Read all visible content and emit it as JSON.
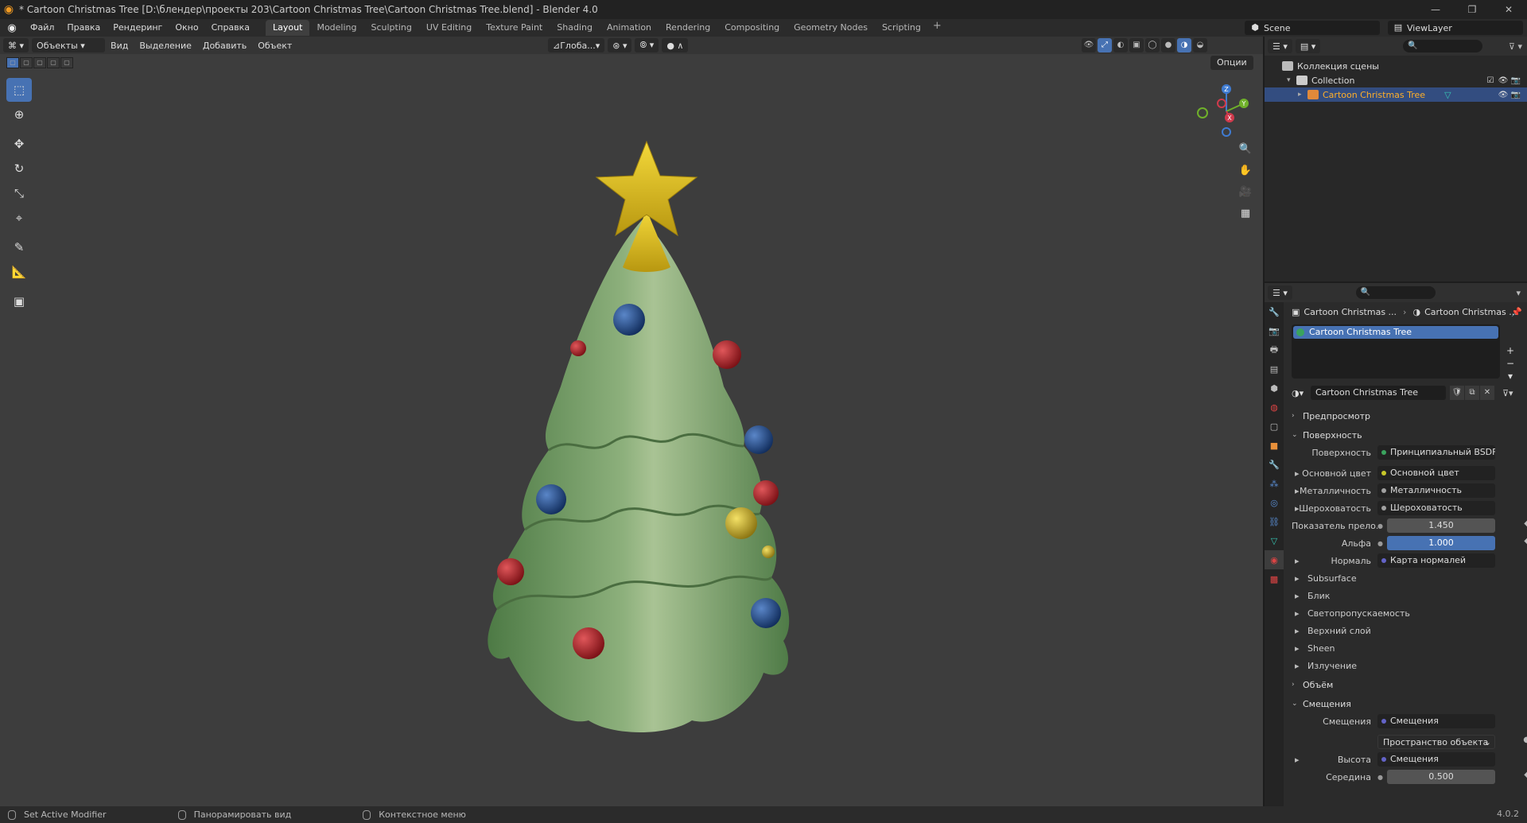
{
  "window": {
    "title": "* Cartoon Christmas Tree [D:\\блендер\\проекты 203\\Cartoon Christmas Tree\\Cartoon Christmas Tree.blend] - Blender 4.0"
  },
  "menu": [
    "Файл",
    "Правка",
    "Рендеринг",
    "Окно",
    "Справка"
  ],
  "workspaces": [
    "Layout",
    "Modeling",
    "Sculpting",
    "UV Editing",
    "Texture Paint",
    "Shading",
    "Animation",
    "Rendering",
    "Compositing",
    "Geometry Nodes",
    "Scripting"
  ],
  "active_workspace": "Layout",
  "scene": {
    "name": "Scene",
    "view_layer": "ViewLayer"
  },
  "viewport": {
    "mode": "Объекты",
    "menus": [
      "Вид",
      "Выделение",
      "Добавить",
      "Объект"
    ],
    "orientation": "Глоба...",
    "options_label": "Опции"
  },
  "outliner": {
    "root": "Коллекция сцены",
    "collection": "Collection",
    "object": "Cartoon Christmas Tree"
  },
  "properties": {
    "breadcrumb_object": "Cartoon Christmas ...",
    "breadcrumb_material": "Cartoon Christmas ...",
    "material_slot": "Cartoon Christmas Tree",
    "material_name": "Cartoon Christmas Tree",
    "panels": {
      "preview": "Предпросмотр",
      "surface": "Поверхность",
      "volume": "Объём",
      "displacement": "Смещения"
    },
    "surface": {
      "label": "Поверхность",
      "value": "Принципиальный BSDF",
      "rows": [
        {
          "label": "Основной цвет",
          "value": "Основной цвет",
          "dot": "#c7c729"
        },
        {
          "label": "Металличность",
          "value": "Металличность",
          "dot": "#a1a1a1"
        },
        {
          "label": "Шероховатость",
          "value": "Шероховатость",
          "dot": "#a1a1a1"
        }
      ],
      "ior_label": "Показатель прело...",
      "ior_value": "1.450",
      "alpha_label": "Альфа",
      "alpha_value": "1.000",
      "normal_label": "Нормаль",
      "normal_value": "Карта нормалей",
      "subpanels": [
        "Subsurface",
        "Блик",
        "Светопропускаемость",
        "Верхний слой",
        "Sheen",
        "Излучение"
      ]
    },
    "displacement": {
      "label": "Смещения",
      "value": "Смещения",
      "space": "Пространство объекта",
      "height_label": "Высота",
      "height_value": "Смещения",
      "midlevel_label": "Середина",
      "midlevel_value": "0.500"
    }
  },
  "status": {
    "left": "Set Active Modifier",
    "middle": "Панорамировать вид",
    "right": "Контекстное меню",
    "version": "4.0.2"
  },
  "gizmo_axes": {
    "z": "Z",
    "y": "Y",
    "x": "X"
  },
  "colors": {
    "accent": "#4772b3",
    "selected_text": "#ffaf29",
    "tree": "#6f9a5f",
    "star": "#e8c51d",
    "ornament_red": "#a61e22",
    "ornament_blue": "#1f4e95"
  }
}
